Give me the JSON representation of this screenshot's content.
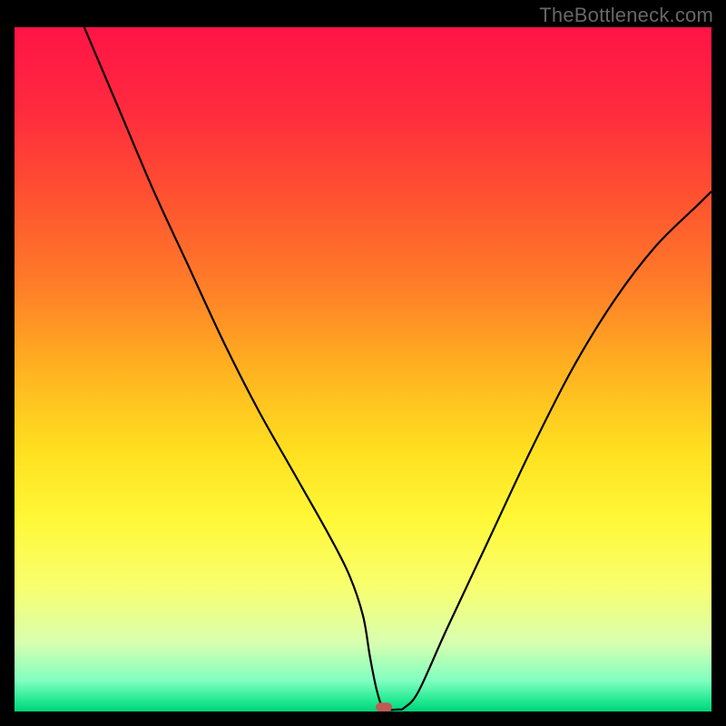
{
  "watermark": "TheBottleneck.com",
  "chart_data": {
    "type": "line",
    "title": "",
    "xlabel": "",
    "ylabel": "",
    "xlim": [
      0,
      100
    ],
    "ylim": [
      0,
      100
    ],
    "grid": false,
    "legend": false,
    "series": [
      {
        "name": "curve",
        "x": [
          10,
          15,
          20,
          25,
          30,
          35,
          40,
          45,
          48,
          50,
          51,
          52,
          53,
          55,
          56,
          58,
          62,
          68,
          74,
          80,
          86,
          92,
          98,
          100
        ],
        "y": [
          100,
          88,
          76,
          65,
          54,
          44,
          35,
          26,
          20,
          14,
          8,
          3,
          0.5,
          0.3,
          0.6,
          3,
          12,
          25,
          38,
          50,
          60,
          68,
          74,
          76
        ]
      }
    ],
    "marker": {
      "x": 53,
      "y": 0.5
    },
    "gradient_stops": [
      {
        "offset": 0.0,
        "color": "#ff1446"
      },
      {
        "offset": 0.12,
        "color": "#ff2a3e"
      },
      {
        "offset": 0.25,
        "color": "#ff5230"
      },
      {
        "offset": 0.38,
        "color": "#ff7e28"
      },
      {
        "offset": 0.5,
        "color": "#ffb220"
      },
      {
        "offset": 0.62,
        "color": "#ffe020"
      },
      {
        "offset": 0.72,
        "color": "#fff838"
      },
      {
        "offset": 0.82,
        "color": "#f8ff70"
      },
      {
        "offset": 0.9,
        "color": "#d8ffb0"
      },
      {
        "offset": 0.955,
        "color": "#80ffc0"
      },
      {
        "offset": 0.985,
        "color": "#20e890"
      },
      {
        "offset": 1.0,
        "color": "#00d27a"
      }
    ]
  }
}
